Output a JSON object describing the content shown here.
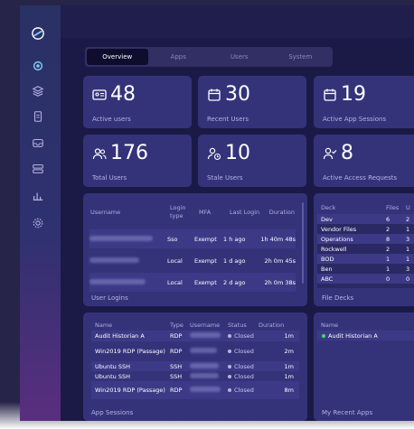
{
  "tabs": [
    "Overview",
    "Apps",
    "Users",
    "System"
  ],
  "stats": [
    {
      "icon": "id-card-icon",
      "value": "48",
      "label": "Active users"
    },
    {
      "icon": "calendar-icon",
      "value": "30",
      "label": "Recent Users"
    },
    {
      "icon": "calendar-icon",
      "value": "19",
      "label": "Active App Sessions"
    },
    {
      "icon": "users-icon",
      "value": "176",
      "label": "Total Users"
    },
    {
      "icon": "user-clock-icon",
      "value": "10",
      "label": "Stale Users"
    },
    {
      "icon": "user-check-icon",
      "value": "8",
      "label": "Active Access Requests"
    }
  ],
  "user_logins": {
    "title": "User Logins",
    "headers": {
      "username": "Username",
      "login_type": "Login type",
      "mfa": "MFA",
      "last_login": "Last Login",
      "duration": "Duration"
    },
    "rows": [
      {
        "login_type": "Sso",
        "mfa": "Exempt",
        "last_login": "1 h ago",
        "duration": "1h 40m 48s"
      },
      {
        "login_type": "Local",
        "mfa": "Exempt",
        "last_login": "1 d ago",
        "duration": "2h 0m 45s"
      },
      {
        "login_type": "Local",
        "mfa": "Exempt",
        "last_login": "2 d ago",
        "duration": "2h 0m 38s"
      }
    ]
  },
  "file_decks": {
    "title": "File Decks",
    "headers": {
      "deck": "Deck",
      "files": "Files",
      "u": "U"
    },
    "rows": [
      {
        "deck": "Dev",
        "files": "6",
        "u": "2"
      },
      {
        "deck": "Vendor Files",
        "files": "2",
        "u": "1"
      },
      {
        "deck": "Operations",
        "files": "8",
        "u": "3"
      },
      {
        "deck": "Rockwell",
        "files": "2",
        "u": "1"
      },
      {
        "deck": "BOD",
        "files": "1",
        "u": "1"
      },
      {
        "deck": "Ben",
        "files": "1",
        "u": "3"
      },
      {
        "deck": "ABC",
        "files": "0",
        "u": "0"
      }
    ]
  },
  "app_sessions": {
    "title": "App Sessions",
    "headers": {
      "name": "Name",
      "type": "Type",
      "username": "Username",
      "status": "Status",
      "duration": "Duration"
    },
    "rows": [
      {
        "name": "Audit Historian A",
        "type": "RDP",
        "status": "Closed",
        "duration": "1m"
      },
      {
        "name": "Win2019 RDP (Passage)",
        "type": "RDP",
        "status": "Closed",
        "duration": "2m"
      },
      {
        "name": "Ubuntu SSH",
        "type": "SSH",
        "status": "Closed",
        "duration": "1m"
      },
      {
        "name": "Ubuntu SSH",
        "type": "SSH",
        "status": "Closed",
        "duration": "1m"
      },
      {
        "name": "Win2019 RDP (Passage)",
        "type": "RDP",
        "status": "Closed",
        "duration": "8m"
      }
    ]
  },
  "recent_apps": {
    "title": "My Recent Apps",
    "headers": {
      "name": "Name"
    },
    "rows": [
      {
        "name": "Audit Historian A"
      }
    ]
  }
}
